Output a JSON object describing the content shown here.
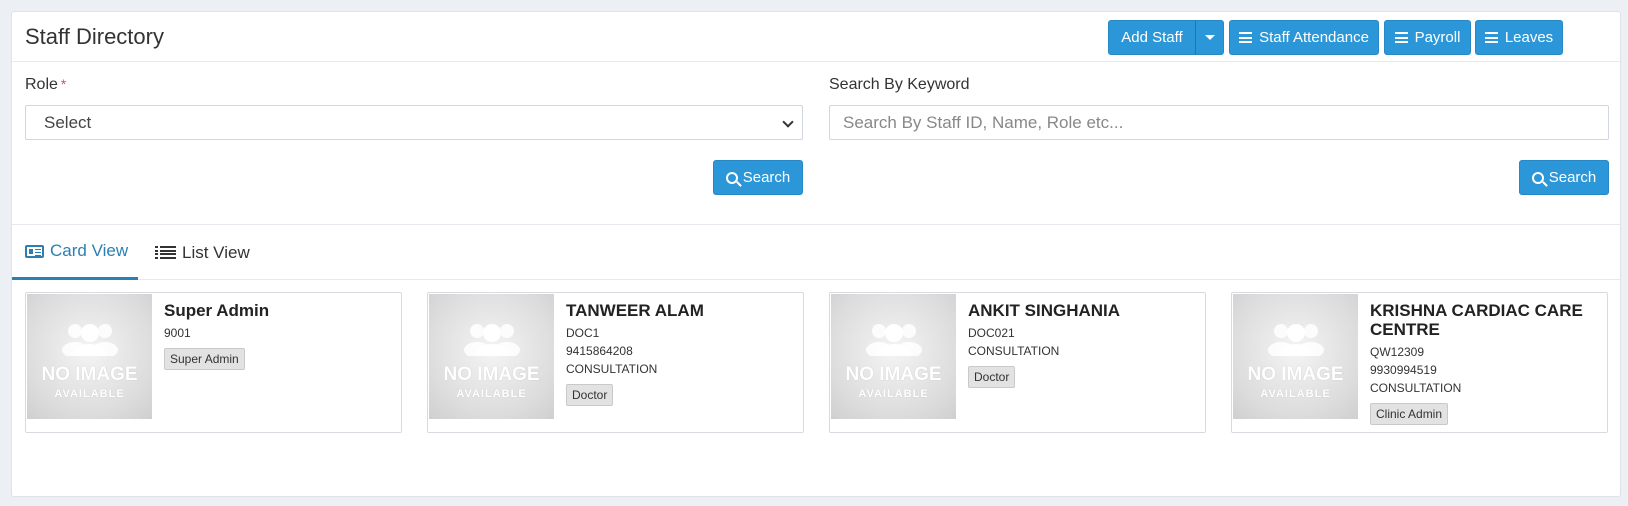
{
  "header": {
    "title": "Staff Directory",
    "buttons": {
      "add_staff": "Add Staff",
      "staff_attendance": "Staff Attendance",
      "payroll": "Payroll",
      "leaves": "Leaves"
    }
  },
  "filters": {
    "role_label": "Role",
    "role_required": "*",
    "role_value": "Select",
    "keyword_label": "Search By Keyword",
    "keyword_placeholder": "Search By Staff ID, Name, Role etc...",
    "search_label": "Search"
  },
  "tabs": [
    {
      "label": "Card View",
      "active": true
    },
    {
      "label": "List View",
      "active": false
    }
  ],
  "no_image": {
    "line1": "NO IMAGE",
    "line2": "AVAILABLE"
  },
  "cards": [
    {
      "name": "Super Admin",
      "lines": [
        "9001"
      ],
      "role": "Super Admin"
    },
    {
      "name": "TANWEER ALAM",
      "lines": [
        "DOC1",
        "9415864208",
        "CONSULTATION"
      ],
      "role": "Doctor"
    },
    {
      "name": "ANKIT SINGHANIA",
      "lines": [
        "DOC021",
        "CONSULTATION"
      ],
      "role": "Doctor"
    },
    {
      "name": "KRISHNA CARDIAC CARE CENTRE",
      "lines": [
        "QW12309",
        "9930994519",
        "CONSULTATION"
      ],
      "role": "Clinic Admin"
    }
  ],
  "colors": {
    "primary": "#2b97d8",
    "tab_active": "#2b7fb3"
  }
}
